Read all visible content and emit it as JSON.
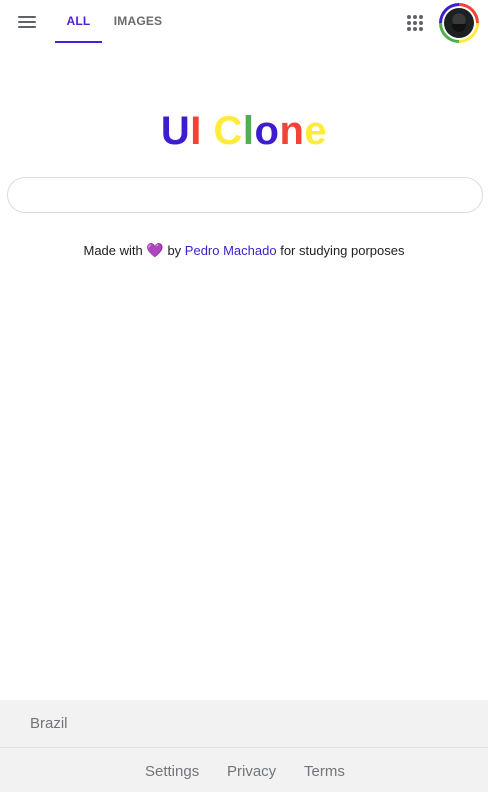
{
  "header": {
    "tabs": [
      {
        "label": "ALL",
        "active": true
      },
      {
        "label": "IMAGES",
        "active": false
      }
    ],
    "icons": {
      "menu": "hamburger-menu-icon",
      "apps": "apps-grid-icon",
      "avatar": "user-avatar"
    }
  },
  "logo": {
    "letters": [
      {
        "char": "U",
        "color": "#3f1bd1"
      },
      {
        "char": "I",
        "color": "#f44336"
      },
      {
        "char": " ",
        "color": "#000000"
      },
      {
        "char": "C",
        "color": "#ffeb3b"
      },
      {
        "char": "l",
        "color": "#4caf50"
      },
      {
        "char": "o",
        "color": "#3f1bd1"
      },
      {
        "char": "n",
        "color": "#f44336"
      },
      {
        "char": "e",
        "color": "#ffeb3b"
      }
    ]
  },
  "search": {
    "value": "",
    "placeholder": ""
  },
  "credit": {
    "prefix": "Made with",
    "heart": "💜",
    "by": "by",
    "author": "Pedro Machado",
    "suffix": "for studying porposes"
  },
  "footer": {
    "country": "Brazil",
    "links": [
      "Settings",
      "Privacy",
      "Terms"
    ]
  },
  "colors": {
    "accent": "#4a1fd6",
    "link": "#3a1fcf",
    "heart": "#b018c2"
  }
}
